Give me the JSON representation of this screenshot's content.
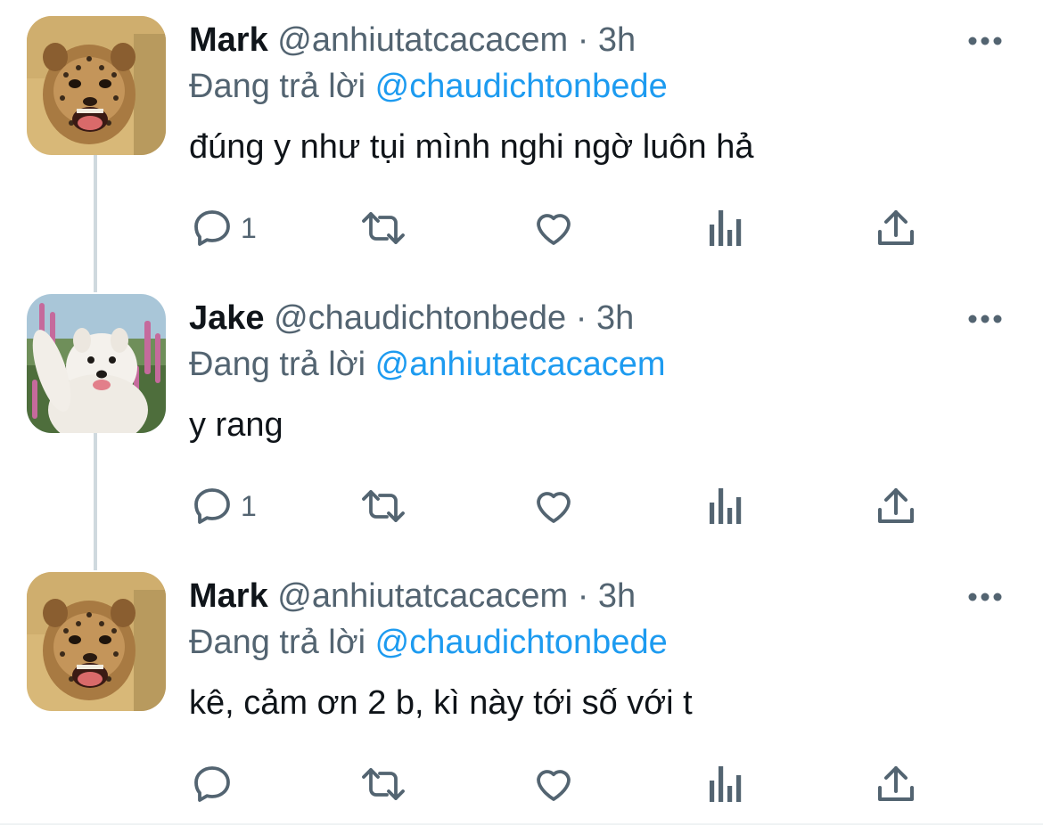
{
  "tweets": [
    {
      "name": "Mark",
      "handle": "@anhiutatcacacem",
      "separator": "·",
      "time": "3h",
      "reply_prefix": "Đang trả lời",
      "reply_to": "@chaudichtonbede",
      "text": "đúng y như tụi mình nghi ngờ luôn hả",
      "reply_count": "1",
      "avatar": "cheetah-cub"
    },
    {
      "name": "Jake",
      "handle": "@chaudichtonbede",
      "separator": "·",
      "time": "3h",
      "reply_prefix": "Đang trả lời",
      "reply_to": "@anhiutatcacacem",
      "text": "y rang",
      "reply_count": "1",
      "avatar": "samoyed-dog"
    },
    {
      "name": "Mark",
      "handle": "@anhiutatcacacem",
      "separator": "·",
      "time": "3h",
      "reply_prefix": "Đang trả lời",
      "reply_to": "@chaudichtonbede",
      "text": "kê, cảm ơn 2 b, kì này tới số với t",
      "reply_count": "",
      "avatar": "cheetah-cub"
    }
  ],
  "colors": {
    "text": "#0f1419",
    "secondary": "#536471",
    "link": "#1d9bf0",
    "thread_line": "#cfd9de"
  },
  "icons": [
    "reply-icon",
    "retweet-icon",
    "like-icon",
    "analytics-icon",
    "share-icon",
    "more-icon"
  ]
}
